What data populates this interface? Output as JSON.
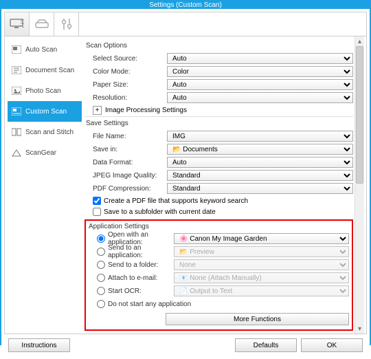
{
  "title": "Settings (Custom Scan)",
  "sidebar": {
    "items": [
      {
        "label": "Auto Scan"
      },
      {
        "label": "Document Scan"
      },
      {
        "label": "Photo Scan"
      },
      {
        "label": "Custom Scan"
      },
      {
        "label": "Scan and Stitch"
      },
      {
        "label": "ScanGear"
      }
    ]
  },
  "scanOptions": {
    "title": "Scan Options",
    "selectSource": {
      "label": "Select Source:",
      "value": "Auto"
    },
    "colorMode": {
      "label": "Color Mode:",
      "value": "Color"
    },
    "paperSize": {
      "label": "Paper Size:",
      "value": "Auto"
    },
    "resolution": {
      "label": "Resolution:",
      "value": "Auto"
    },
    "imageProcessing": "Image Processing Settings"
  },
  "saveSettings": {
    "title": "Save Settings",
    "fileName": {
      "label": "File Name:",
      "value": "IMG"
    },
    "saveIn": {
      "label": "Save in:",
      "value": "Documents"
    },
    "dataFormat": {
      "label": "Data Format:",
      "value": "Auto"
    },
    "jpegQuality": {
      "label": "JPEG Image Quality:",
      "value": "Standard"
    },
    "pdfCompression": {
      "label": "PDF Compression:",
      "value": "Standard"
    },
    "pdfKeyword": {
      "label": "Create a PDF file that supports keyword search",
      "checked": true
    },
    "subfolder": {
      "label": "Save to a subfolder with current date",
      "checked": false
    }
  },
  "appSettings": {
    "title": "Application Settings",
    "openWith": {
      "label": "Open with an application:",
      "value": "Canon My Image Garden"
    },
    "sendApp": {
      "label": "Send to an application:",
      "value": "Preview"
    },
    "sendFolder": {
      "label": "Send to a folder:",
      "value": "None"
    },
    "attachEmail": {
      "label": "Attach to e-mail:",
      "value": "None (Attach Manually)"
    },
    "startOCR": {
      "label": "Start OCR:",
      "value": "Output to Text"
    },
    "doNotStart": {
      "label": "Do not start any application"
    },
    "moreFunctions": "More Functions"
  },
  "footer": {
    "instructions": "Instructions",
    "defaults": "Defaults",
    "ok": "OK"
  }
}
